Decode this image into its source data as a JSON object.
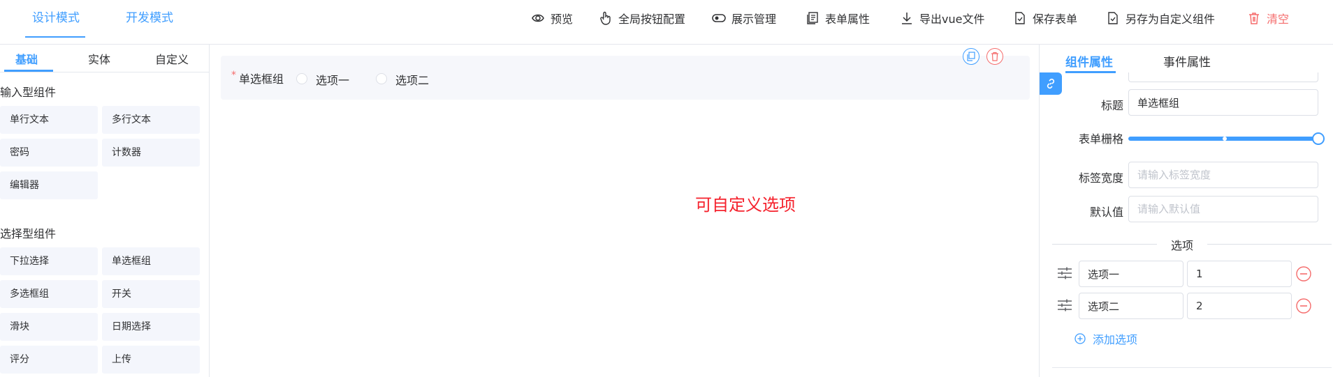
{
  "header": {
    "modes": [
      "设计模式",
      "开发模式"
    ],
    "toolbar": {
      "preview": "预览",
      "global_buttons": "全局按钮配置",
      "display_manage": "展示管理",
      "form_props": "表单属性",
      "export_vue": "导出vue文件",
      "save_form": "保存表单",
      "save_as_custom": "另存为自定义组件",
      "clear": "清空"
    }
  },
  "left_panel": {
    "tabs": [
      "基础",
      "实体",
      "自定义"
    ],
    "input_group_title": "输入型组件",
    "input_components": [
      "单行文本",
      "多行文本",
      "密码",
      "计数器",
      "编辑器"
    ],
    "select_group_title": "选择型组件",
    "select_components": [
      "下拉选择",
      "单选框组",
      "多选框组",
      "开关",
      "滑块",
      "日期选择",
      "评分",
      "上传"
    ]
  },
  "canvas": {
    "item_label": "单选框组",
    "required_mark": "*",
    "options": [
      "选项一",
      "选项二"
    ],
    "message": "可自定义选项"
  },
  "right_panel": {
    "tabs": [
      "组件属性",
      "事件属性"
    ],
    "props": {
      "title_label": "标题",
      "title_value": "单选框组",
      "span_label": "表单栅格",
      "span_value": 24,
      "span_max": 24,
      "label_width_label": "标签宽度",
      "label_width_placeholder": "请输入标签宽度",
      "default_label": "默认值",
      "default_placeholder": "请输入默认值"
    },
    "options_title": "选项",
    "option_rows": [
      {
        "label": "选项一",
        "value": "1"
      },
      {
        "label": "选项二",
        "value": "2"
      }
    ],
    "add_option": "添加选项"
  },
  "colors": {
    "primary": "#409eff",
    "danger": "#f56c6c",
    "message": "#f5222d"
  }
}
